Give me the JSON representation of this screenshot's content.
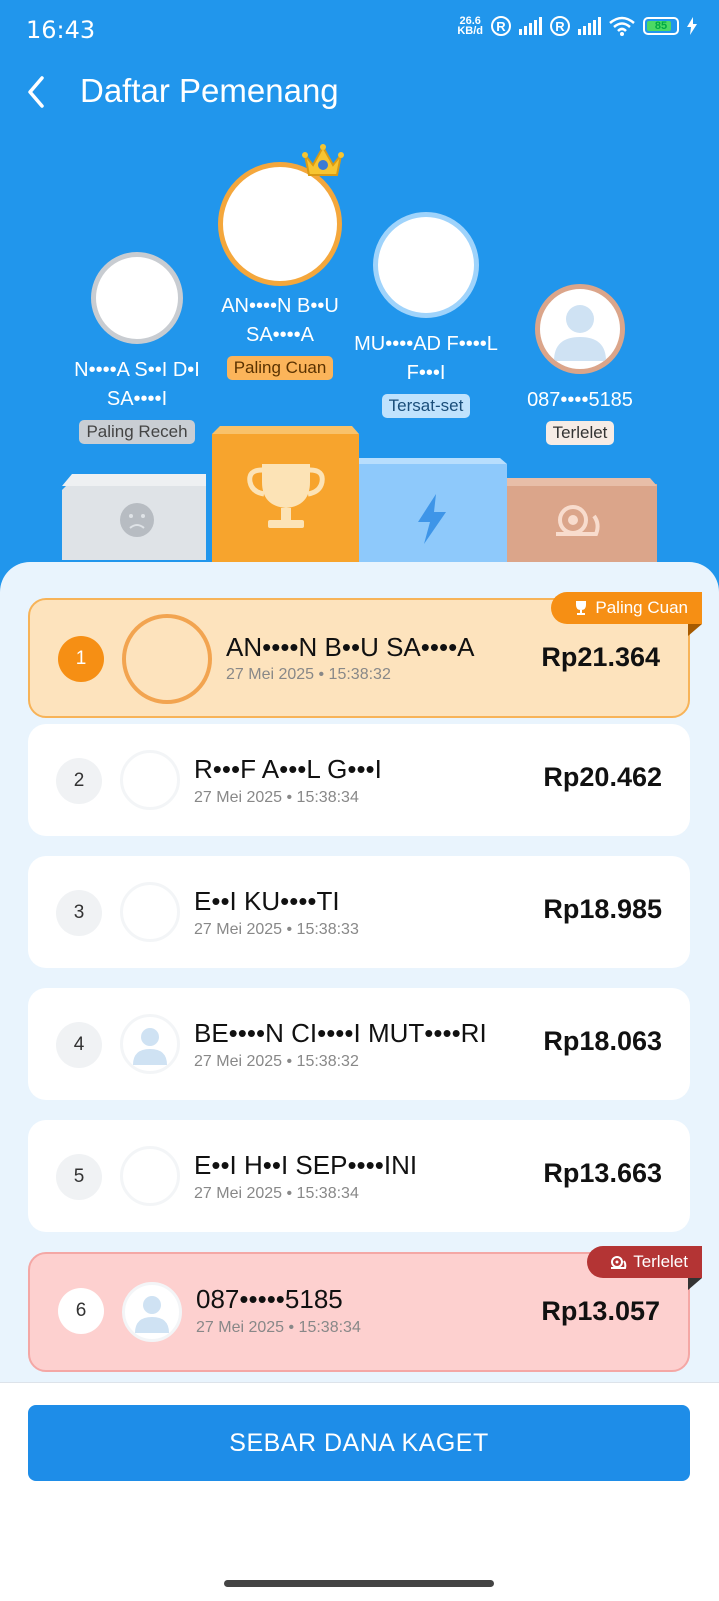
{
  "status_bar": {
    "time": "16:43",
    "net_speed_top": "26.6",
    "net_speed_unit": "KB/d",
    "roaming_1": "R",
    "roaming_2": "R",
    "battery": "85"
  },
  "header": {
    "title": "Daftar Pemenang"
  },
  "top_winners": {
    "receh": {
      "name": "N••••A S••I D•I SA••••I",
      "tag": "Paling Receh"
    },
    "cuan": {
      "name": "AN••••N B••U SA••••A",
      "tag": "Paling Cuan"
    },
    "cepat": {
      "name": "MU••••AD F••••L F•••I",
      "tag": "Tersat-set"
    },
    "lelet": {
      "name": "087••••5185",
      "tag": "Terlelet"
    }
  },
  "winners": [
    {
      "rank": "1",
      "name": "AN••••N B••U SA••••A",
      "date": "27 Mei 2025 • 15:38:32",
      "amount": "Rp21.364",
      "ribbon": "Paling Cuan"
    },
    {
      "rank": "2",
      "name": "R•••F A•••L G•••I",
      "date": "27 Mei 2025 • 15:38:34",
      "amount": "Rp20.462"
    },
    {
      "rank": "3",
      "name": "E••I KU••••TI",
      "date": "27 Mei 2025 • 15:38:33",
      "amount": "Rp18.985"
    },
    {
      "rank": "4",
      "name": "BE••••N CI••••I MUT••••RI",
      "date": "27 Mei 2025 • 15:38:32",
      "amount": "Rp18.063"
    },
    {
      "rank": "5",
      "name": "E••I H••I SEP••••INI",
      "date": "27 Mei 2025 • 15:38:34",
      "amount": "Rp13.663"
    },
    {
      "rank": "6",
      "name": "087•••••5185",
      "date": "27 Mei 2025 • 15:38:34",
      "amount": "Rp13.057",
      "ribbon": "Terlelet"
    }
  ],
  "button": {
    "label": "SEBAR DANA KAGET"
  },
  "colors": {
    "primary": "#2196ec",
    "gold": "#f59a1b",
    "silver": "#dfe3e7",
    "blue_podium": "#8ec9fb",
    "bronze": "#dba58a",
    "lelet_bg": "#fdd0cf"
  }
}
